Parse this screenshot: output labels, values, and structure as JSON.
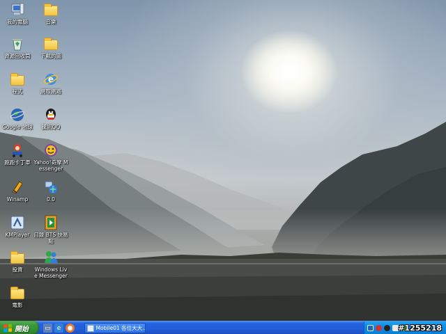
{
  "desktop": {
    "icons": [
      {
        "label": "我的電腦",
        "icon": "my-computer-icon"
      },
      {
        "label": "音樂",
        "icon": "folder-icon"
      },
      {
        "label": "資源回收筒",
        "icon": "recycle-bin-icon"
      },
      {
        "label": "下載的圖",
        "icon": "folder-icon"
      },
      {
        "label": "程式",
        "icon": "folder-icon"
      },
      {
        "label": "網際網路",
        "icon": "internet-explorer-icon"
      },
      {
        "label": "Google 地球",
        "icon": "google-earth-icon"
      },
      {
        "label": "騰訊QQ",
        "icon": "qq-icon"
      },
      {
        "label": "跑跑卡丁車",
        "icon": "kartrider-icon"
      },
      {
        "label": "Yahoo!奇摩 Messenger",
        "icon": "yahoo-messenger-icon"
      },
      {
        "label": "Winamp",
        "icon": "winamp-icon"
      },
      {
        "label": "0.0",
        "icon": "network-app-icon"
      },
      {
        "label": "KMPlayer",
        "icon": "kmplayer-icon"
      },
      {
        "label": "目錄 BTS 快易點",
        "icon": "bts-app-icon"
      },
      {
        "label": "投資",
        "icon": "folder-icon"
      },
      {
        "label": "Windows Live Messenger",
        "icon": "windows-live-messenger-icon"
      },
      {
        "label": "電影",
        "icon": "folder-icon"
      }
    ]
  },
  "taskbar": {
    "start_label": "開始",
    "quick_launch": [
      "show-desktop-icon",
      "internet-explorer-icon",
      "firefox-icon"
    ],
    "tasks": [
      {
        "label": "Mobile01 各位大大...",
        "icon": "browser-window-icon"
      }
    ],
    "tray_icons": [
      "network-icon",
      "security-icon",
      "qq-tray-icon",
      "volume-icon",
      "messenger-tray-icon"
    ]
  },
  "watermark": "#1255218",
  "colors": {
    "taskbar_blue": "#245edb",
    "start_green": "#3c9a3c",
    "tray_blue": "#0f8ee2"
  }
}
